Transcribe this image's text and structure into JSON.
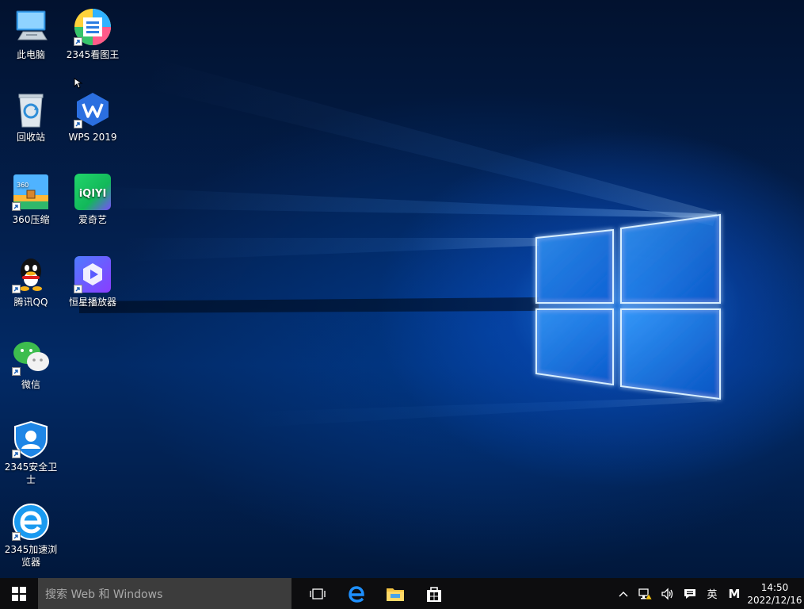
{
  "desktop": {
    "icons": [
      {
        "label": "此电脑",
        "icon": "this-pc-icon"
      },
      {
        "label": "2345看图王",
        "icon": "image-viewer-icon"
      },
      {
        "label": "回收站",
        "icon": "recycle-bin-icon"
      },
      {
        "label": "WPS 2019",
        "icon": "wps-icon"
      },
      {
        "label": "360压缩",
        "icon": "archive-icon"
      },
      {
        "label": "爱奇艺",
        "icon": "iqiyi-icon"
      },
      {
        "label": "腾讯QQ",
        "icon": "qq-icon"
      },
      {
        "label": "恒星播放器",
        "icon": "media-player-icon"
      },
      {
        "label": "微信",
        "icon": "wechat-icon"
      },
      {
        "label": "2345安全卫士",
        "icon": "security-icon"
      },
      {
        "label": "2345加速浏览器",
        "icon": "browser-icon"
      }
    ],
    "iqiyi_logo_text": "iQIYI"
  },
  "taskbar": {
    "search_placeholder": "搜索 Web 和 Windows",
    "buttons": [
      "task-view-icon",
      "edge-icon",
      "file-explorer-icon",
      "store-icon"
    ],
    "tray": {
      "chevron": "^",
      "ime": "英",
      "ime_mode": "M"
    },
    "clock": {
      "time": "14:50",
      "date": "2022/12/16"
    }
  },
  "colors": {
    "taskbar_bg": "#0d0d0f",
    "search_bg": "#3c3c3c",
    "accent": "#1e90ff"
  }
}
